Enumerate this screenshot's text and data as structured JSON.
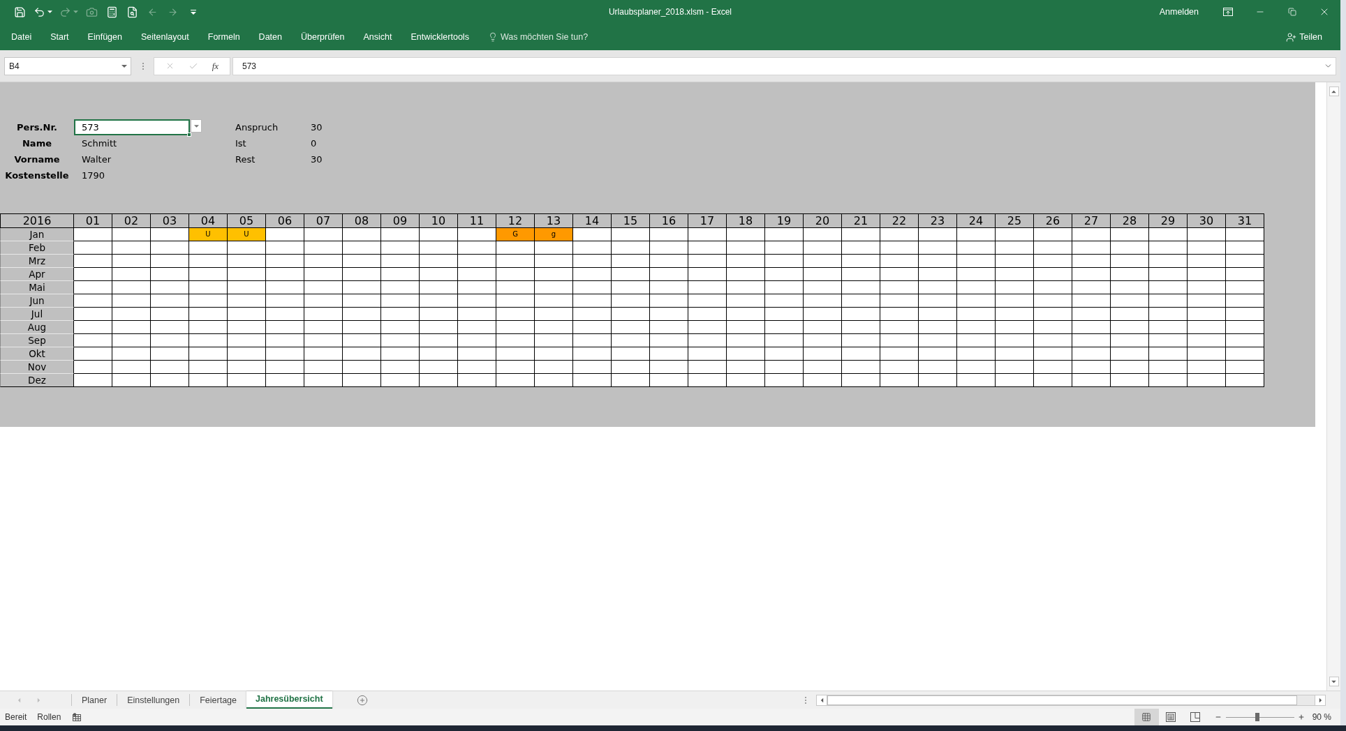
{
  "window": {
    "title": "Urlaubsplaner_2018.xlsm - Excel",
    "account": "Anmelden"
  },
  "quick_access": [
    {
      "kind": "save",
      "disabled": false
    },
    {
      "kind": "undo",
      "disabled": false
    },
    {
      "kind": "redo",
      "disabled": true
    },
    {
      "kind": "camera",
      "disabled": true
    },
    {
      "kind": "calculator",
      "disabled": false
    },
    {
      "kind": "print_preview",
      "disabled": false
    },
    {
      "kind": "back",
      "disabled": true
    },
    {
      "kind": "forward",
      "disabled": true
    },
    {
      "kind": "customize",
      "disabled": false
    }
  ],
  "ribbon": {
    "tabs": [
      "Datei",
      "Start",
      "Einfügen",
      "Seitenlayout",
      "Formeln",
      "Daten",
      "Überprüfen",
      "Ansicht",
      "Entwicklertools"
    ],
    "tell_me": "Was möchten Sie tun?",
    "share": "Teilen"
  },
  "formula_bar": {
    "name_box": "B4",
    "buttons_disabled": true,
    "function_label": "fx",
    "formula": "573"
  },
  "sheet": {
    "fields": [
      {
        "label": "Pers.Nr.",
        "value": "573",
        "selected": true
      },
      {
        "label": "Name",
        "value": "Schmitt",
        "selected": false
      },
      {
        "label": "Vorname",
        "value": "Walter",
        "selected": false
      },
      {
        "label": "Kostenstelle",
        "value": "1790",
        "selected": false
      }
    ],
    "balance": [
      {
        "label": "Anspruch",
        "value": "30"
      },
      {
        "label": "Ist",
        "value": "0"
      },
      {
        "label": "Rest",
        "value": "30"
      }
    ],
    "calendar": {
      "year": "2016",
      "days": [
        "01",
        "02",
        "03",
        "04",
        "05",
        "06",
        "07",
        "08",
        "09",
        "10",
        "11",
        "12",
        "13",
        "14",
        "15",
        "16",
        "17",
        "18",
        "19",
        "20",
        "21",
        "22",
        "23",
        "24",
        "25",
        "26",
        "27",
        "28",
        "29",
        "30",
        "31"
      ],
      "months": [
        {
          "name": "Jan",
          "cells": [
            {
              "kind": "blank"
            },
            {
              "kind": "blank"
            },
            {
              "kind": "blank"
            },
            {
              "kind": "entry",
              "text": "U",
              "color": "#ffc000"
            },
            {
              "kind": "entry",
              "text": "U",
              "color": "#ffc000"
            },
            {
              "kind": "blank"
            },
            {
              "kind": "blank"
            },
            {
              "kind": "blank"
            },
            {
              "kind": "blank"
            },
            {
              "kind": "blank"
            },
            {
              "kind": "blank"
            },
            {
              "kind": "entry",
              "text": "G",
              "color": "#ff9900"
            },
            {
              "kind": "entry",
              "text": "g",
              "color": "#ff9900"
            },
            {
              "kind": "blank"
            },
            {
              "kind": "blank"
            },
            {
              "kind": "blank"
            },
            {
              "kind": "blank"
            },
            {
              "kind": "blank"
            },
            {
              "kind": "blank"
            },
            {
              "kind": "blank"
            },
            {
              "kind": "blank"
            },
            {
              "kind": "blank"
            },
            {
              "kind": "blank"
            },
            {
              "kind": "blank"
            },
            {
              "kind": "blank"
            },
            {
              "kind": "blank"
            },
            {
              "kind": "blank"
            },
            {
              "kind": "blank"
            },
            {
              "kind": "blank"
            },
            {
              "kind": "blank"
            },
            {
              "kind": "blank"
            }
          ]
        },
        {
          "name": "Feb"
        },
        {
          "name": "Mrz"
        },
        {
          "name": "Apr"
        },
        {
          "name": "Mai"
        },
        {
          "name": "Jun"
        },
        {
          "name": "Jul"
        },
        {
          "name": "Aug"
        },
        {
          "name": "Sep"
        },
        {
          "name": "Okt"
        },
        {
          "name": "Nov"
        },
        {
          "name": "Dez"
        }
      ]
    }
  },
  "sheet_tabs": [
    {
      "label": "Planer",
      "selected": false
    },
    {
      "label": "Einstellungen",
      "selected": false
    },
    {
      "label": "Feiertage",
      "selected": false
    },
    {
      "label": "Jahresübersicht",
      "selected": true
    }
  ],
  "status_bar": {
    "mode": "Bereit",
    "scroll_lock": "Rollen",
    "views": [
      {
        "kind": "normal",
        "selected": true
      },
      {
        "kind": "page_layout",
        "selected": false
      },
      {
        "kind": "page_break",
        "selected": false
      }
    ],
    "zoom_slider": {
      "level": 0.46
    },
    "zoom": "90 %"
  }
}
